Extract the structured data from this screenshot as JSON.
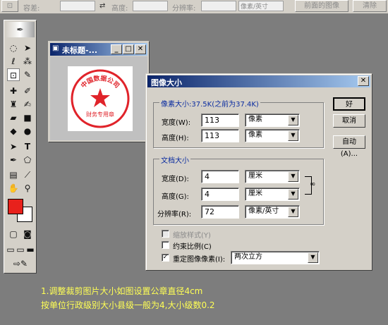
{
  "options_bar": {
    "label_1": "容差:",
    "label_2": "高度:",
    "label_3": "分辨率:",
    "unit_select": "像素/英寸",
    "front_image_button": "前面的图像",
    "clear_button": "清除"
  },
  "document": {
    "title": "未标题-...",
    "seal_text": "中国数据公司",
    "seal_sub": "财务专用章"
  },
  "dialog": {
    "title": "图像大小",
    "pixel_group": {
      "legend": "像素大小:37.5K(之前为37.4K)",
      "width_label": "宽度(W):",
      "width_value": "113",
      "width_unit": "像素",
      "height_label": "高度(H):",
      "height_value": "113",
      "height_unit": "像素"
    },
    "doc_group": {
      "legend": "文档大小",
      "width_label": "宽度(D):",
      "width_value": "4",
      "width_unit": "厘米",
      "height_label": "高度(G):",
      "height_value": "4",
      "height_unit": "厘米",
      "res_label": "分辨率(R):",
      "res_value": "72",
      "res_unit": "像素/英寸"
    },
    "options": {
      "scale_styles": "缩放样式(Y)",
      "constrain": "约束比例(C)",
      "resample": "重定图像像素(I):",
      "resample_method": "两次立方"
    },
    "buttons": {
      "ok": "好",
      "cancel": "取消",
      "auto": "自动(A)..."
    }
  },
  "caption": {
    "line1": "1.调整裁剪图片大小如图设置公章直径4cm",
    "line2": "按单位行政级别大小县级一般为4,大小级数0.2"
  },
  "colors": {
    "foreground": "#e8211c",
    "background": "#ffffff",
    "seal_red": "#e0232a",
    "caption_yellow": "#ffff55"
  }
}
